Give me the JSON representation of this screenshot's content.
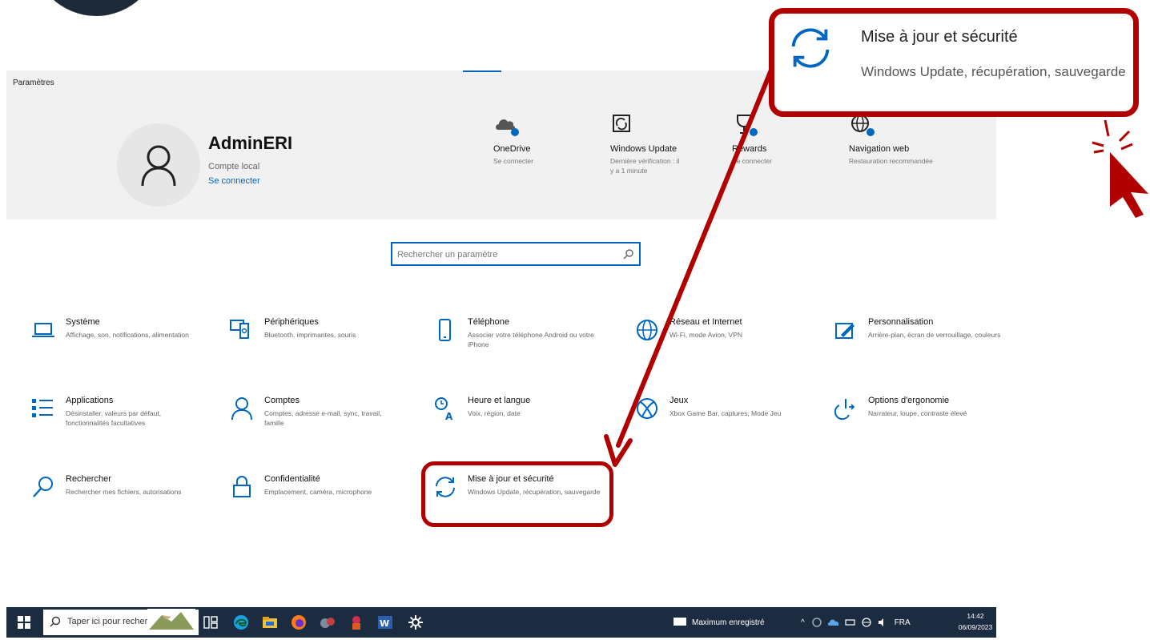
{
  "window": {
    "title": "Paramètres"
  },
  "user": {
    "name": "AdminERI",
    "account_type": "Compte local",
    "sign_in_link": "Se connecter"
  },
  "quick": [
    {
      "title": "OneDrive",
      "subtitle": "Se connecter",
      "icon": "cloud-icon"
    },
    {
      "title": "Windows Update",
      "subtitle": "Dernière vérification : il y a 1 minute",
      "icon": "windows-update-icon"
    },
    {
      "title": "Rewards",
      "subtitle": "Se connecter",
      "icon": "trophy-icon"
    },
    {
      "title": "Navigation web",
      "subtitle": "Restauration recommandée",
      "icon": "web-globe-icon"
    }
  ],
  "search": {
    "placeholder": "Rechercher un paramètre"
  },
  "tiles": [
    {
      "title": "Système",
      "desc": "Affichage, son, notifications, alimentation",
      "icon": "laptop-icon"
    },
    {
      "title": "Périphériques",
      "desc": "Bluetooth, imprimantes, souris",
      "icon": "devices-icon"
    },
    {
      "title": "Téléphone",
      "desc": "Associer votre téléphone Android ou votre iPhone",
      "icon": "phone-icon"
    },
    {
      "title": "Réseau et Internet",
      "desc": "Wi-Fi, mode Avion, VPN",
      "icon": "globe-icon"
    },
    {
      "title": "Personnalisation",
      "desc": "Arrière-plan, écran de verrouillage, couleurs",
      "icon": "paintbrush-icon"
    },
    {
      "title": "Applications",
      "desc": "Désinstaller, valeurs par défaut, fonctionnalités facultatives",
      "icon": "apps-list-icon"
    },
    {
      "title": "Comptes",
      "desc": "Comptes, adresse e-mail, sync, travail, famille",
      "icon": "person-icon"
    },
    {
      "title": "Heure et langue",
      "desc": "Voix, région, date",
      "icon": "time-language-icon"
    },
    {
      "title": "Jeux",
      "desc": "Xbox Game Bar, captures, Mode Jeu",
      "icon": "xbox-icon"
    },
    {
      "title": "Options d'ergonomie",
      "desc": "Narrateur, loupe, contraste élevé",
      "icon": "accessibility-icon"
    },
    {
      "title": "Rechercher",
      "desc": "Rechercher mes fichiers, autorisations",
      "icon": "search-icon"
    },
    {
      "title": "Confidentialité",
      "desc": "Emplacement, caméra, microphone",
      "icon": "lock-icon"
    },
    {
      "title": "Mise à jour et sécurité",
      "desc": "Windows Update, récupération, sauvegarde",
      "icon": "sync-icon"
    }
  ],
  "callout": {
    "title": "Mise à jour et sécurité",
    "desc": "Windows Update, récupération, sauvegarde"
  },
  "taskbar": {
    "search_placeholder": "Taper ici pour rechercher",
    "notification": "Maximum enregistré",
    "language": "FRA",
    "time": "14:42",
    "date": "06/09/2023"
  },
  "colors": {
    "accent": "#0067c0",
    "callout_red": "#b00000",
    "taskbar": "#1c2c40",
    "header_band": "#f1f1f1"
  }
}
